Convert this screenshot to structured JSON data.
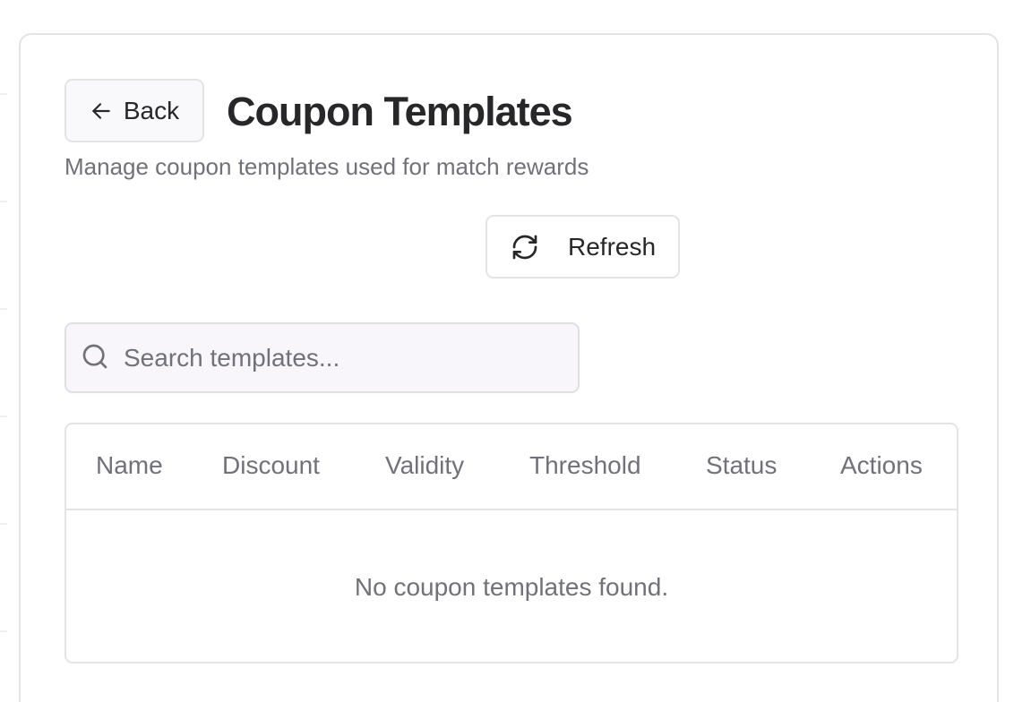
{
  "header": {
    "back_label": "Back",
    "title": "Coupon Templates",
    "subtitle": "Manage coupon templates used for match rewards"
  },
  "toolbar": {
    "refresh_label": "Refresh"
  },
  "search": {
    "placeholder": "Search templates...",
    "value": ""
  },
  "table": {
    "columns": [
      "Name",
      "Discount",
      "Validity",
      "Threshold",
      "Status",
      "Actions"
    ],
    "empty_message": "No coupon templates found."
  },
  "icons": {
    "back": "arrow-left-icon",
    "refresh": "refresh-icon",
    "search": "search-icon"
  },
  "colors": {
    "text_primary": "#27272a",
    "text_muted": "#71717a",
    "border": "#e4e4e7",
    "input_bg": "#f8f6fa"
  }
}
